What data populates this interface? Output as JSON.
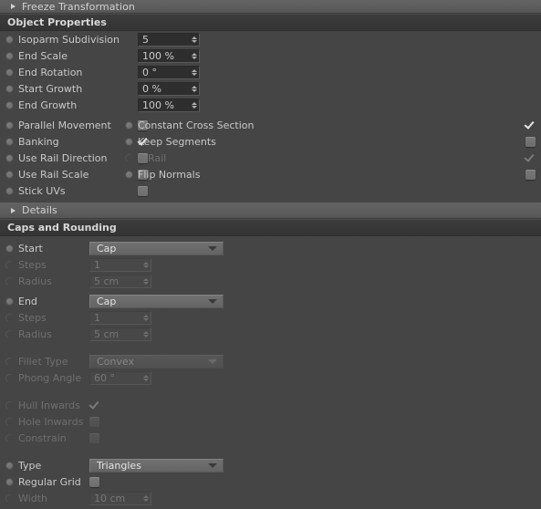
{
  "app": {
    "theme_bg": "#454545",
    "accent_text": "#c9c9c9"
  },
  "top_group": {
    "label": "Freeze Transformation",
    "expanded": false
  },
  "object_properties": {
    "header": "Object Properties",
    "numeric_fields": [
      {
        "label": "Isoparm Subdivision",
        "value": "5",
        "leader": false,
        "enabled": true
      },
      {
        "label": "End Scale",
        "value": "100 %",
        "leader": true,
        "enabled": true
      },
      {
        "label": "End Rotation",
        "value": "0 °",
        "leader": true,
        "enabled": true
      },
      {
        "label": "Start Growth",
        "value": "0 %",
        "leader": true,
        "enabled": true
      },
      {
        "label": "End Growth",
        "value": "100 %",
        "leader": true,
        "enabled": true
      }
    ],
    "checkbox_left": [
      {
        "label": "Parallel Movement",
        "checked": false,
        "enabled": true,
        "leader": false
      },
      {
        "label": "Banking",
        "checked": true,
        "enabled": true,
        "leader": true
      },
      {
        "label": "Use Rail Direction",
        "checked": false,
        "enabled": true,
        "leader": false
      },
      {
        "label": "Use Rail Scale",
        "checked": false,
        "enabled": true,
        "leader": true
      },
      {
        "label": "Stick UVs",
        "checked": false,
        "enabled": true,
        "leader": true
      }
    ],
    "checkbox_right": [
      {
        "label": "Constant Cross Section",
        "checked": true,
        "enabled": true,
        "leader": false
      },
      {
        "label": "Keep Segments",
        "checked": false,
        "enabled": true,
        "leader": true
      },
      {
        "label": "2-Rail",
        "checked": true,
        "enabled": false,
        "leader": true
      },
      {
        "label": "Flip Normals",
        "checked": false,
        "enabled": true,
        "leader": true
      }
    ],
    "details_group": {
      "label": "Details",
      "expanded": false
    }
  },
  "caps_and_rounding": {
    "header": "Caps and Rounding",
    "start": {
      "label": "Start",
      "value": "Cap",
      "enabled": true,
      "steps": {
        "label": "Steps",
        "value": "1",
        "enabled": false
      },
      "radius": {
        "label": "Radius",
        "value": "5 cm",
        "enabled": false
      }
    },
    "end": {
      "label": "End",
      "value": "Cap",
      "enabled": true,
      "steps": {
        "label": "Steps",
        "value": "1",
        "enabled": false
      },
      "radius": {
        "label": "Radius",
        "value": "5 cm",
        "enabled": false
      }
    },
    "fillet_type": {
      "label": "Fillet Type",
      "value": "Convex",
      "enabled": false
    },
    "phong_angle": {
      "label": "Phong Angle",
      "value": "60 °",
      "enabled": false
    },
    "hull_inwards": {
      "label": "Hull Inwards",
      "checked": true,
      "enabled": false
    },
    "hole_inwards": {
      "label": "Hole Inwards",
      "checked": false,
      "enabled": false
    },
    "constrain": {
      "label": "Constrain",
      "checked": false,
      "enabled": false
    },
    "type": {
      "label": "Type",
      "value": "Triangles",
      "enabled": true
    },
    "regular_grid": {
      "label": "Regular Grid",
      "checked": false,
      "enabled": true
    },
    "width": {
      "label": "Width",
      "value": "10 cm",
      "enabled": false
    }
  }
}
